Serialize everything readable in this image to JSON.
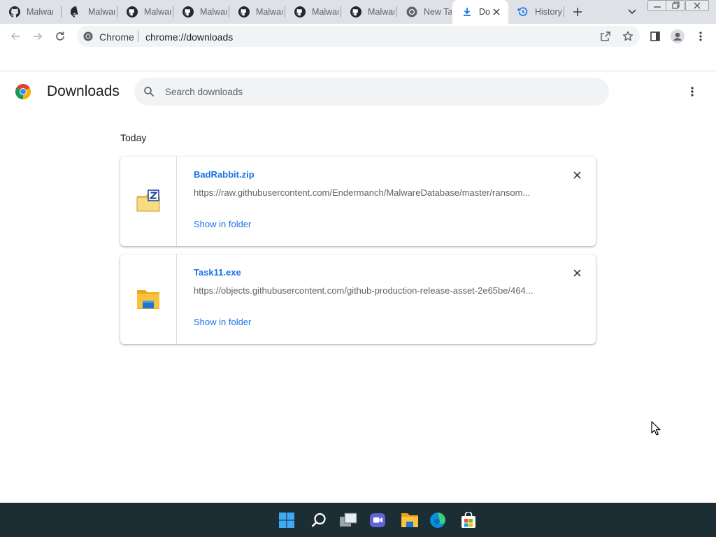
{
  "browser": {
    "tabs": [
      {
        "title": "Malwar",
        "icon": "github-icon"
      },
      {
        "title": "Malwar",
        "icon": "github-icon"
      },
      {
        "title": "Malwar",
        "icon": "github-icon"
      },
      {
        "title": "Malwar",
        "icon": "github-icon"
      },
      {
        "title": "Malwar",
        "icon": "github-icon"
      },
      {
        "title": "Malwar",
        "icon": "github-icon"
      },
      {
        "title": "Malwar",
        "icon": "github-icon"
      },
      {
        "title": "New Ta",
        "icon": "chrome-icon"
      },
      {
        "title": "Do",
        "icon": "download-icon",
        "active": true
      },
      {
        "title": "History",
        "icon": "history-icon"
      }
    ],
    "omnibox": {
      "site_chip": "Chrome",
      "url": "chrome://downloads"
    }
  },
  "page": {
    "title": "Downloads",
    "search": {
      "placeholder": "Search downloads",
      "value": ""
    },
    "section_label": "Today",
    "downloads": [
      {
        "file_name": "BadRabbit.zip",
        "url": "https://raw.githubusercontent.com/Endermanch/MalwareDatabase/master/ransom...",
        "action": "Show in folder",
        "file_type_icon": "zip-folder-icon"
      },
      {
        "file_name": "Task11.exe",
        "url": "https://objects.githubusercontent.com/github-production-release-asset-2e65be/464...",
        "action": "Show in folder",
        "file_type_icon": "exe-folder-icon"
      }
    ]
  },
  "taskbar": {
    "apps": [
      "start-icon",
      "search-icon",
      "task-view-icon",
      "chat-icon",
      "file-explorer-icon",
      "edge-icon",
      "store-icon"
    ]
  },
  "colors": {
    "tabstrip_bg": "#dee1e6",
    "link": "#1a73e8",
    "taskbar_bg": "#1c2d33"
  }
}
